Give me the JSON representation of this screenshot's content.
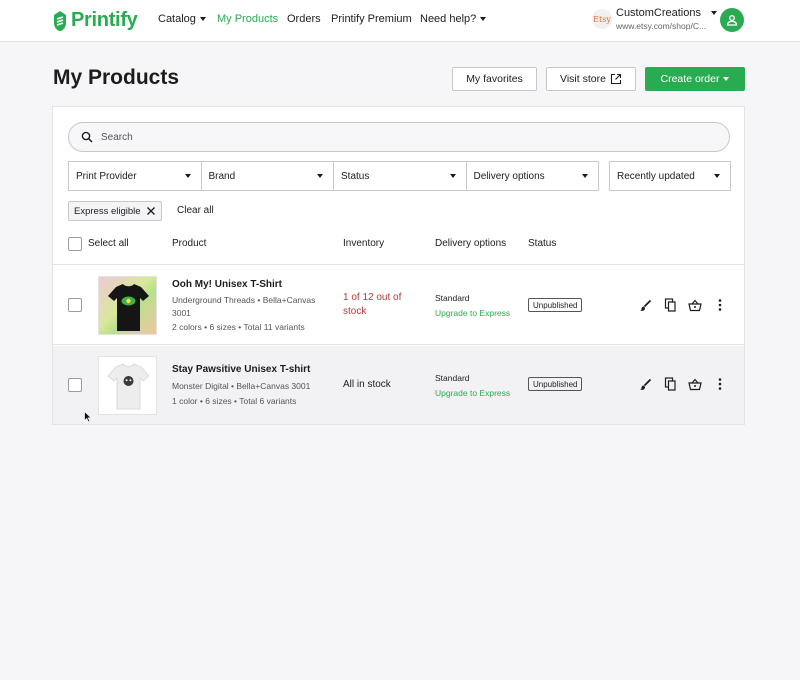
{
  "brand": {
    "name": "Printify",
    "color": "#29ab51"
  },
  "nav": [
    {
      "label": "Catalog",
      "has_dropdown": true,
      "active": false
    },
    {
      "label": "My Products",
      "has_dropdown": false,
      "active": true
    },
    {
      "label": "Orders",
      "has_dropdown": false,
      "active": false
    },
    {
      "label": "Printify Premium",
      "has_dropdown": false,
      "active": false
    },
    {
      "label": "Need help?",
      "has_dropdown": true,
      "active": false
    }
  ],
  "shop": {
    "logo_text": "Etsy",
    "name": "CustomCreations",
    "url": "www.etsy.com/shop/C..."
  },
  "page": {
    "title": "My Products",
    "favorites_label": "My favorites",
    "visit_store_label": "Visit store",
    "create_order_label": "Create order"
  },
  "search": {
    "placeholder": "Search"
  },
  "filters": [
    {
      "label": "Print Provider"
    },
    {
      "label": "Brand"
    },
    {
      "label": "Status"
    },
    {
      "label": "Delivery options"
    }
  ],
  "sort": {
    "label": "Recently updated"
  },
  "active_chip": {
    "label": "Express eligible"
  },
  "clear_all_label": "Clear all",
  "table": {
    "headers": {
      "select_all": "Select all",
      "product": "Product",
      "inventory": "Inventory",
      "delivery": "Delivery options",
      "status": "Status"
    },
    "rows": [
      {
        "title": "Ooh My! Unisex T-Shirt",
        "provider_line1": "Underground Threads • Bella+Canvas",
        "provider_line2": "3001",
        "variants": "2 colors • 6 sizes • Total 11 variants",
        "inventory_line1": "1 of 12 out of",
        "inventory_line2": "stock",
        "delivery": "Standard",
        "upgrade": "Upgrade to Express",
        "status": "Unpublished"
      },
      {
        "title": "Stay Pawsitive Unisex T-shirt",
        "provider_line1": "Monster Digital • Bella+Canvas 3001",
        "variants": "1 color • 6 sizes • Total 6 variants",
        "inventory_line1": "All in stock",
        "delivery": "Standard",
        "upgrade": "Upgrade to Express",
        "status": "Unpublished"
      }
    ]
  },
  "colors": {
    "accent": "#29ab51",
    "out_of_stock": "#b5393a",
    "background": "#f6f6f8"
  },
  "icons": [
    "printify-logo-icon",
    "search-icon",
    "external-link-icon",
    "user-icon",
    "edit-brush-icon",
    "duplicate-icon",
    "basket-icon",
    "more-vertical-icon",
    "close-icon",
    "chevron-down-icon",
    "cursor-icon"
  ]
}
